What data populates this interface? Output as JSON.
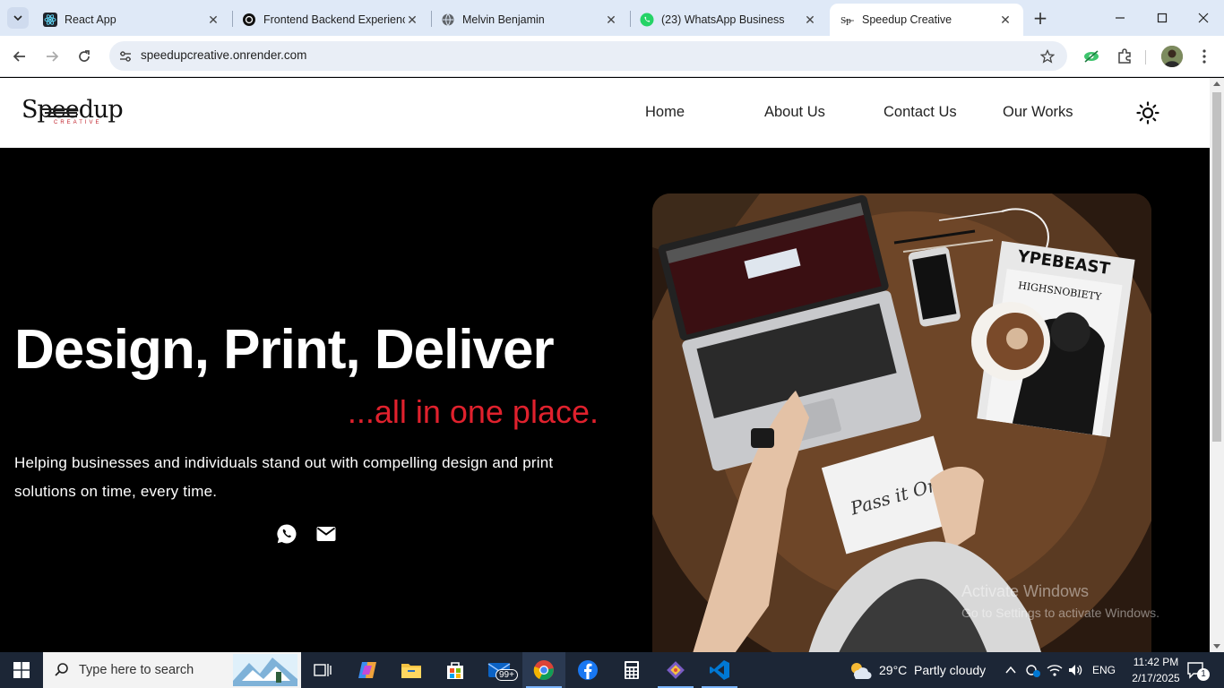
{
  "browser": {
    "tabs": [
      {
        "title": "React App",
        "icon": "react-icon"
      },
      {
        "title": "Frontend Backend Experienc",
        "icon": "openai-icon"
      },
      {
        "title": "Melvin Benjamin",
        "icon": "globe-icon"
      },
      {
        "title": "(23) WhatsApp Business",
        "icon": "whatsapp-icon"
      },
      {
        "title": "Speedup Creative",
        "icon": "speedup-icon",
        "active": true
      }
    ],
    "url": "speedupcreative.onrender.com"
  },
  "site": {
    "logo": {
      "text": "Speedup",
      "sub": "CREATIVE"
    },
    "nav": [
      "Home",
      "About Us",
      "Contact Us",
      "Our Works"
    ],
    "hero": {
      "title": "Design, Print, Deliver",
      "subtitle": "...all in one place.",
      "description": "Helping businesses and individuals stand out with compelling design and print solutions on time, every time."
    },
    "accent_color": "#e0212d"
  },
  "watermark": {
    "line1": "Activate Windows",
    "line2": "Go to Settings to activate Windows."
  },
  "taskbar": {
    "search_placeholder": "Type here to search",
    "mail_badge": "99+",
    "weather": {
      "temp": "29°C",
      "condition": "Partly cloudy"
    },
    "language": "ENG",
    "time": "11:42 PM",
    "date": "2/17/2025",
    "notification_count": "1"
  }
}
